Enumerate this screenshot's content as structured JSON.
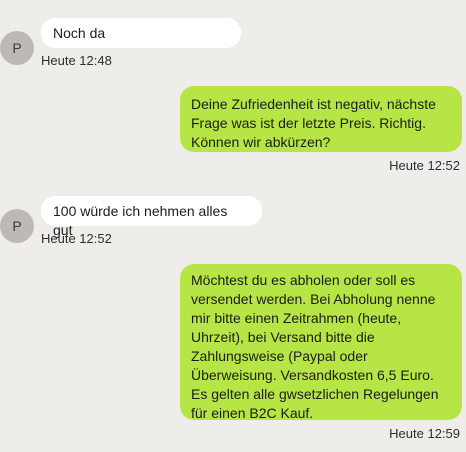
{
  "chat": {
    "messages": [
      {
        "direction": "incoming",
        "avatar_initial": "P",
        "text": "Noch da",
        "time": "Heute 12:48"
      },
      {
        "direction": "outgoing",
        "text": "Deine Zufriedenheit ist negativ, nächste Frage was ist der letzte Preis. Richtig. Können wir abkürzen?",
        "time": "Heute 12:52"
      },
      {
        "direction": "incoming",
        "avatar_initial": "P",
        "text": "100 würde ich nehmen alles gut",
        "time": "Heute 12:52"
      },
      {
        "direction": "outgoing",
        "text": "Möchtest du es abholen oder soll es versendet werden. Bei Abholung nenne mir bitte einen Zeitrahmen (heute, Uhrzeit), bei Versand bitte die Zahlungsweise (Paypal oder Überweisung. Versandkosten 6,5 Euro. Es gelten alle gwsetzlichen Regelungen für einen B2C Kauf.",
        "time": "Heute 12:59"
      }
    ]
  },
  "colors": {
    "background": "#efedea",
    "incoming_bubble": "#ffffff",
    "outgoing_bubble": "#b7e545",
    "avatar": "#bdbab5"
  }
}
